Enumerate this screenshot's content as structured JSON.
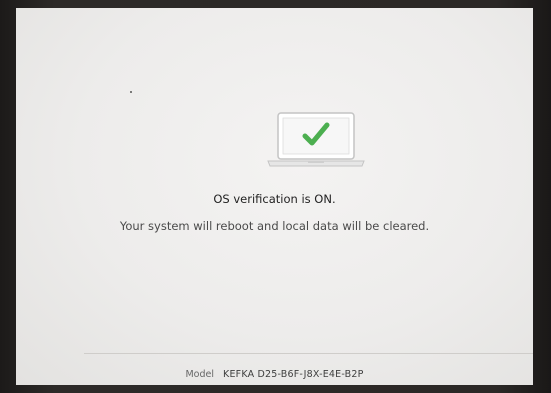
{
  "screen": {
    "title": "OS verification is ON.",
    "message": "Your system will reboot and local data will be cleared."
  },
  "icon": {
    "name": "laptop-checkmark-icon",
    "check_color": "#4caf50"
  },
  "footer": {
    "model_label": "Model",
    "model_value": "KEFKA D25-B6F-J8X-E4E-B2P"
  },
  "colors": {
    "background": "#edeceb",
    "text_primary": "#222222",
    "text_secondary": "#4a4a4a",
    "check": "#4caf50"
  }
}
